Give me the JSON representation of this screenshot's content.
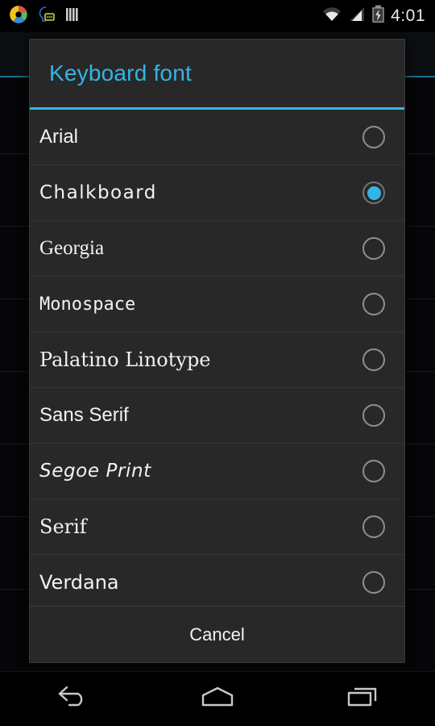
{
  "status_bar": {
    "time": "4:01",
    "left_icons": [
      {
        "name": "app-pinwheel-icon",
        "label": "pinwheel"
      },
      {
        "name": "voice-typing-icon",
        "label": "voice input"
      },
      {
        "name": "barcode-icon",
        "label": "barcode"
      }
    ],
    "right_icons": [
      {
        "name": "wifi-icon",
        "label": "wifi"
      },
      {
        "name": "cellular-signal-icon",
        "label": "signal"
      },
      {
        "name": "battery-charging-icon",
        "label": "battery charging"
      }
    ]
  },
  "dialog": {
    "title": "Keyboard font",
    "accent_color": "#33b5e5",
    "background_color": "#282828",
    "selected_index": 1,
    "options": [
      {
        "label": "Arial",
        "font_class": "f-arial",
        "selected": false
      },
      {
        "label": "Chalkboard",
        "font_class": "f-chalk",
        "selected": true
      },
      {
        "label": "Georgia",
        "font_class": "f-georgia",
        "selected": false
      },
      {
        "label": "Monospace",
        "font_class": "f-mono",
        "selected": false
      },
      {
        "label": "Palatino Linotype",
        "font_class": "f-palatino",
        "selected": false
      },
      {
        "label": "Sans Serif",
        "font_class": "f-sans",
        "selected": false
      },
      {
        "label": "Segoe Print",
        "font_class": "f-segoe",
        "selected": false
      },
      {
        "label": "Serif",
        "font_class": "f-serif",
        "selected": false
      },
      {
        "label": "Verdana",
        "font_class": "f-verdana",
        "selected": false
      }
    ],
    "cancel_label": "Cancel"
  },
  "nav_bar": {
    "buttons": [
      {
        "name": "back-button",
        "icon": "back-icon"
      },
      {
        "name": "home-button",
        "icon": "home-icon"
      },
      {
        "name": "recents-button",
        "icon": "recents-icon"
      }
    ]
  }
}
